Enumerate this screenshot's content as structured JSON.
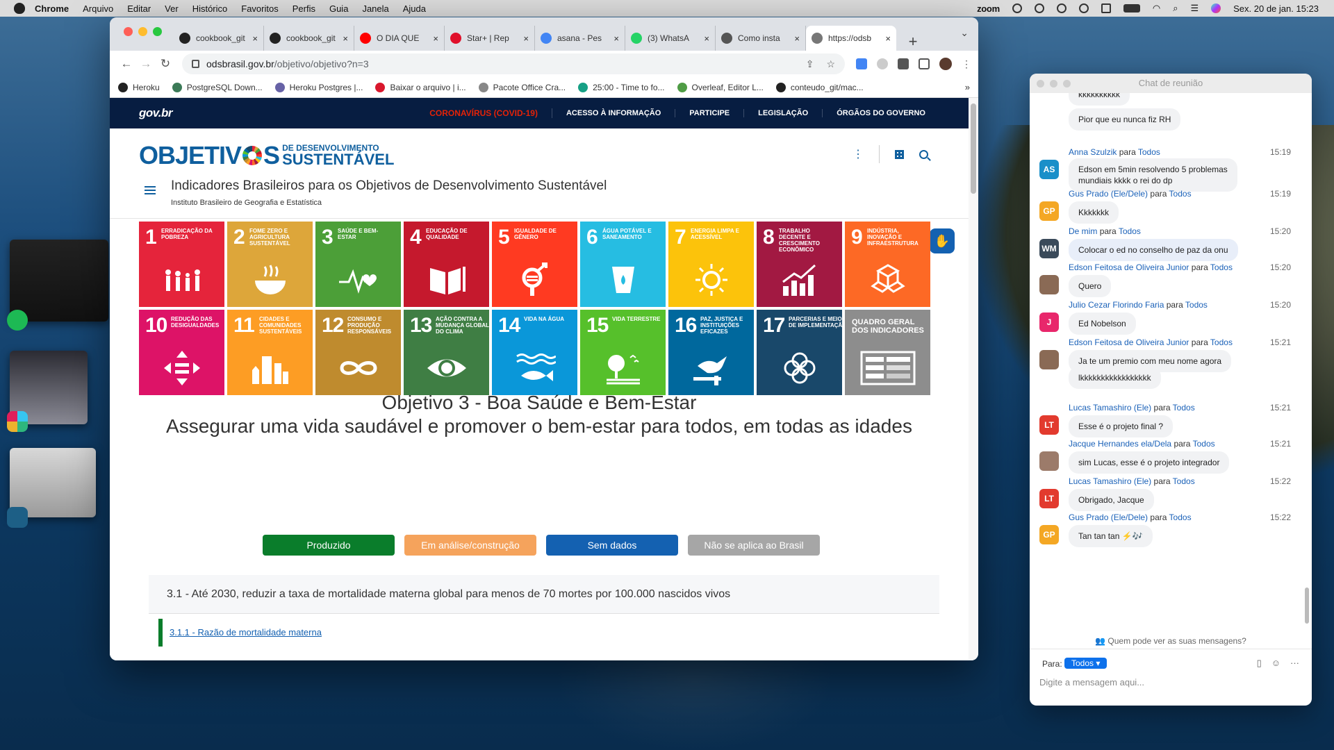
{
  "menubar": {
    "app": "Chrome",
    "items": [
      "Arquivo",
      "Editar",
      "Ver",
      "Histórico",
      "Favoritos",
      "Perfis",
      "Guia",
      "Janela",
      "Ajuda"
    ],
    "zoom": "zoom",
    "datetime": "Sex. 20 de jan.  15:23"
  },
  "browser": {
    "tabs": [
      {
        "title": "cookbook_git",
        "icon": "github-icon",
        "color": "#222"
      },
      {
        "title": "cookbook_git",
        "icon": "github-icon",
        "color": "#222"
      },
      {
        "title": "O DIA QUE",
        "icon": "youtube-icon",
        "color": "#ff0000"
      },
      {
        "title": "Star+ | Rep",
        "icon": "star-icon",
        "color": "#e0102b"
      },
      {
        "title": "asana - Pes",
        "icon": "google-icon",
        "color": "#4285f4"
      },
      {
        "title": "(3) WhatsA",
        "icon": "whatsapp-icon",
        "color": "#25d366"
      },
      {
        "title": "Como insta",
        "icon": "page-icon",
        "color": "#555"
      },
      {
        "title": "https://odsb",
        "icon": "page-icon",
        "color": "#777",
        "active": true
      }
    ],
    "url_host": "odsbrasil.gov.br",
    "url_path": "/objetivo/objetivo?n=3",
    "bookmarks": [
      {
        "label": "Heroku",
        "color": "#222"
      },
      {
        "label": "PostgreSQL Down...",
        "color": "#3b7a57"
      },
      {
        "label": "Heroku Postgres |...",
        "color": "#6762a6"
      },
      {
        "label": "Baixar o arquivo | i...",
        "color": "#d9182d"
      },
      {
        "label": "Pacote Office Cra...",
        "color": "#888"
      },
      {
        "label": "25:00 - Time to fo...",
        "color": "#16a085"
      },
      {
        "label": "Overleaf, Editor L...",
        "color": "#4f9c45"
      },
      {
        "label": "conteudo_git/mac...",
        "color": "#222"
      }
    ],
    "bookmarks_more": "»"
  },
  "site": {
    "gov_logo": "gov.br",
    "gov_nav": [
      "CORONAVÍRUS (COVID-19)",
      "ACESSO À INFORMAÇÃO",
      "PARTICIPE",
      "LEGISLAÇÃO",
      "ÓRGÃOS DO GOVERNO"
    ],
    "brand_big": "OBJETIV",
    "brand_s": "S",
    "brand_sub1": "DE DESENVOLVIMENTO",
    "brand_sub2": "SUSTENTÁVEL",
    "title": "Indicadores Brasileiros para os Objetivos de Desenvolvimento Sustentável",
    "subtitle": "Instituto Brasileiro de Geografia e Estatística",
    "goals": [
      {
        "n": "1",
        "label": "ERRADICAÇÃO DA POBREZA",
        "color": "#e5243b"
      },
      {
        "n": "2",
        "label": "FOME ZERO E AGRICULTURA SUSTENTÁVEL",
        "color": "#dda63a"
      },
      {
        "n": "3",
        "label": "SAÚDE E BEM-ESTAR",
        "color": "#4c9f38"
      },
      {
        "n": "4",
        "label": "EDUCAÇÃO DE QUALIDADE",
        "color": "#c5192d"
      },
      {
        "n": "5",
        "label": "IGUALDADE DE GÊNERO",
        "color": "#ff3a21"
      },
      {
        "n": "6",
        "label": "ÁGUA POTÁVEL E SANEAMENTO",
        "color": "#26bde2"
      },
      {
        "n": "7",
        "label": "ENERGIA LIMPA E ACESSÍVEL",
        "color": "#fcc30b"
      },
      {
        "n": "8",
        "label": "TRABALHO DECENTE E CRESCIMENTO ECONÔMICO",
        "color": "#a21942"
      },
      {
        "n": "9",
        "label": "INDÚSTRIA, INOVAÇÃO E INFRAESTRUTURA",
        "color": "#fd6925"
      },
      {
        "n": "10",
        "label": "REDUÇÃO DAS DESIGUALDADES",
        "color": "#dd1367"
      },
      {
        "n": "11",
        "label": "CIDADES E COMUNIDADES SUSTENTÁVEIS",
        "color": "#fd9d24"
      },
      {
        "n": "12",
        "label": "CONSUMO E PRODUÇÃO RESPONSÁVEIS",
        "color": "#bf8b2e"
      },
      {
        "n": "13",
        "label": "AÇÃO CONTRA A MUDANÇA GLOBAL DO CLIMA",
        "color": "#3f7e44"
      },
      {
        "n": "14",
        "label": "VIDA NA ÁGUA",
        "color": "#0a97d9"
      },
      {
        "n": "15",
        "label": "VIDA TERRESTRE",
        "color": "#56c02b"
      },
      {
        "n": "16",
        "label": "PAZ, JUSTIÇA E INSTITUIÇÕES EFICAZES",
        "color": "#00689d"
      },
      {
        "n": "17",
        "label": "PARCERIAS E MEIOS DE IMPLEMENTAÇÃO",
        "color": "#19486a"
      },
      {
        "n": "",
        "label": "QUADRO GERAL DOS INDICADORES",
        "color": "#8d8d8d",
        "overview": true
      }
    ],
    "objective_line1": "Objetivo 3 - Boa Saúde e Bem-Estar",
    "objective_line2": "Assegurar uma vida saudável e promover o bem-estar para todos, em todas as idades",
    "status": [
      {
        "label": "Produzido",
        "color": "#0a7d2b"
      },
      {
        "label": "Em análise/construção",
        "color": "#f5a35c"
      },
      {
        "label": "Sem dados",
        "color": "#1461b1"
      },
      {
        "label": "Não se aplica ao Brasil",
        "color": "#a6a6a6"
      }
    ],
    "target": "3.1 - Até 2030, reduzir a taxa de mortalidade materna global para menos de 70 mortes por 100.000 nascidos vivos",
    "indicator": "3.1.1 - Razão de mortalidade materna"
  },
  "chat": {
    "title": "Chat de reunião",
    "to_word": "para",
    "messages": [
      {
        "bubble": "kkkkkkkkkk",
        "cut": true
      },
      {
        "bubble": "Pior que eu nunca fiz RH"
      },
      {
        "name": "Anna Szulzik",
        "to": "Todos",
        "time": "15:19",
        "initials": "AS",
        "avcolor": "#1a8fc9",
        "bubble": "Edson em 5min resolvendo 5 problemas",
        "bubble2": "mundiais kkkk o rei do dp"
      },
      {
        "name": "Gus Prado (Ele/Dele)",
        "to": "Todos",
        "time": "15:19",
        "initials": "GP",
        "avcolor": "#f4a724",
        "bubble": "Kkkkkkk"
      },
      {
        "name": "De mim",
        "to": "Todos",
        "time": "15:20",
        "initials": "WM",
        "avcolor": "#3a4a5a",
        "bubble": "Colocar o ed no conselho de paz da onu",
        "self": true
      },
      {
        "name": "Edson Feitosa de Oliveira Junior",
        "to": "Todos",
        "time": "15:20",
        "initials": "",
        "avcolor": "#8a6a55",
        "bubble": "Quero"
      },
      {
        "name": "Julio Cezar Florindo Faria",
        "to": "Todos",
        "time": "15:20",
        "initials": "J",
        "avcolor": "#e8276b",
        "bubble": "Ed Nobelson"
      },
      {
        "name": "Edson Feitosa de Oliveira Junior",
        "to": "Todos",
        "time": "15:21",
        "initials": "",
        "avcolor": "#8a6a55",
        "bubble": "Ja te um premio com meu nome agora"
      },
      {
        "bubble": "lkkkkkkkkkkkkkkkkk"
      },
      {
        "name": "Lucas Tamashiro (Ele)",
        "to": "Todos",
        "time": "15:21",
        "initials": "LT",
        "avcolor": "#e23a2e",
        "bubble": "Esse é o projeto final ?"
      },
      {
        "name": "Jacque Hernandes ela/Dela",
        "to": "Todos",
        "time": "15:21",
        "initials": "",
        "avcolor": "#9c7b6a",
        "bubble": "sim Lucas, esse é o projeto integrador"
      },
      {
        "name": "Lucas Tamashiro (Ele)",
        "to": "Todos",
        "time": "15:22",
        "initials": "LT",
        "avcolor": "#e23a2e",
        "bubble": "Obrigado, Jacque"
      },
      {
        "name": "Gus Prado (Ele/Dele)",
        "to": "Todos",
        "time": "15:22",
        "initials": "GP",
        "avcolor": "#f4a724",
        "bubble": "Tan tan tan ⚡🎶"
      }
    ],
    "privacy": "Quem pode ver as suas mensagens?",
    "to_label": "Para:",
    "to_value": "Todos ▾",
    "placeholder": "Digite a mensagem aqui..."
  }
}
